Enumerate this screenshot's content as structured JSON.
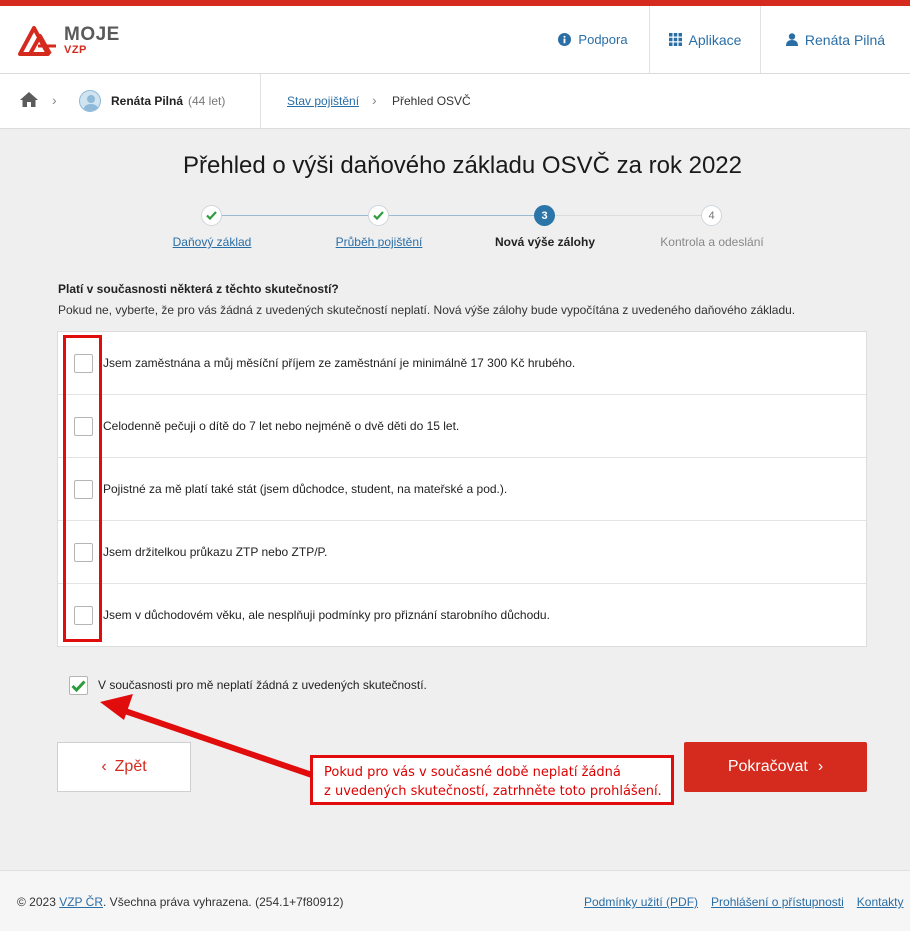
{
  "header": {
    "logo_main": "MOJE",
    "logo_sub": "VZP",
    "nav": {
      "support": "Podpora",
      "apps": "Aplikace",
      "user": "Renáta Pilná"
    }
  },
  "breadcrumb": {
    "person_name": "Renáta Pilná",
    "person_age": "(44 let)",
    "link": "Stav pojištění",
    "current": "Přehled OSVČ"
  },
  "page_title": "Přehled o výši daňového základu OSVČ za rok 2022",
  "steps": [
    {
      "label": "Daňový základ",
      "state": "done"
    },
    {
      "label": "Průběh pojištění",
      "state": "done"
    },
    {
      "label": "Nová výše zálohy",
      "state": "active",
      "number": "3"
    },
    {
      "label": "Kontrola a odeslání",
      "state": "todo",
      "number": "4"
    }
  ],
  "form": {
    "question": "Platí v současnosti některá z těchto skutečností?",
    "hint": "Pokud ne, vyberte, že pro vás žádná z uvedených skutečností neplatí. Nová výše zálohy bude vypočítána z uvedeného daňového základu.",
    "options": [
      {
        "label": "Jsem zaměstnána a můj měsíční příjem ze zaměstnání je minimálně 17 300 Kč hrubého.",
        "checked": false
      },
      {
        "label": "Celodenně pečuji o dítě do 7 let nebo nejméně o dvě děti do 15 let.",
        "checked": false
      },
      {
        "label": "Pojistné za mě platí také stát (jsem důchodce, student, na mateřské a pod.).",
        "checked": false
      },
      {
        "label": "Jsem držitelkou průkazu ZTP nebo ZTP/P.",
        "checked": false
      },
      {
        "label": "Jsem v důchodovém věku, ale nesplňuji podmínky pro přiznání starobního důchodu.",
        "checked": false
      }
    ],
    "none_applies": {
      "label": "V současnosti pro mě neplatí žádná z uvedených skutečností.",
      "checked": true
    }
  },
  "buttons": {
    "back": "Zpět",
    "next": "Pokračovat"
  },
  "annotation": {
    "line1": "Pokud pro vás v současné době neplatí žádná",
    "line2": "z uvedených skutečností, zatrhněte toto prohlášení."
  },
  "footer": {
    "copyright_prefix": "© 2023",
    "org_link": "VZP ČR",
    "copyright_suffix": ". Všechna práva vyhrazena. (254.1+7f80912)",
    "links": [
      "Podmínky užití (PDF)",
      "Prohlášení o přístupnosti",
      "Kontakty"
    ]
  },
  "colors": {
    "brand_red": "#d52b1e",
    "link_blue": "#2a6ea6",
    "step_active": "#2b75a8",
    "check_green": "#2e9b3c",
    "annotation_red": "#e10c0c"
  }
}
